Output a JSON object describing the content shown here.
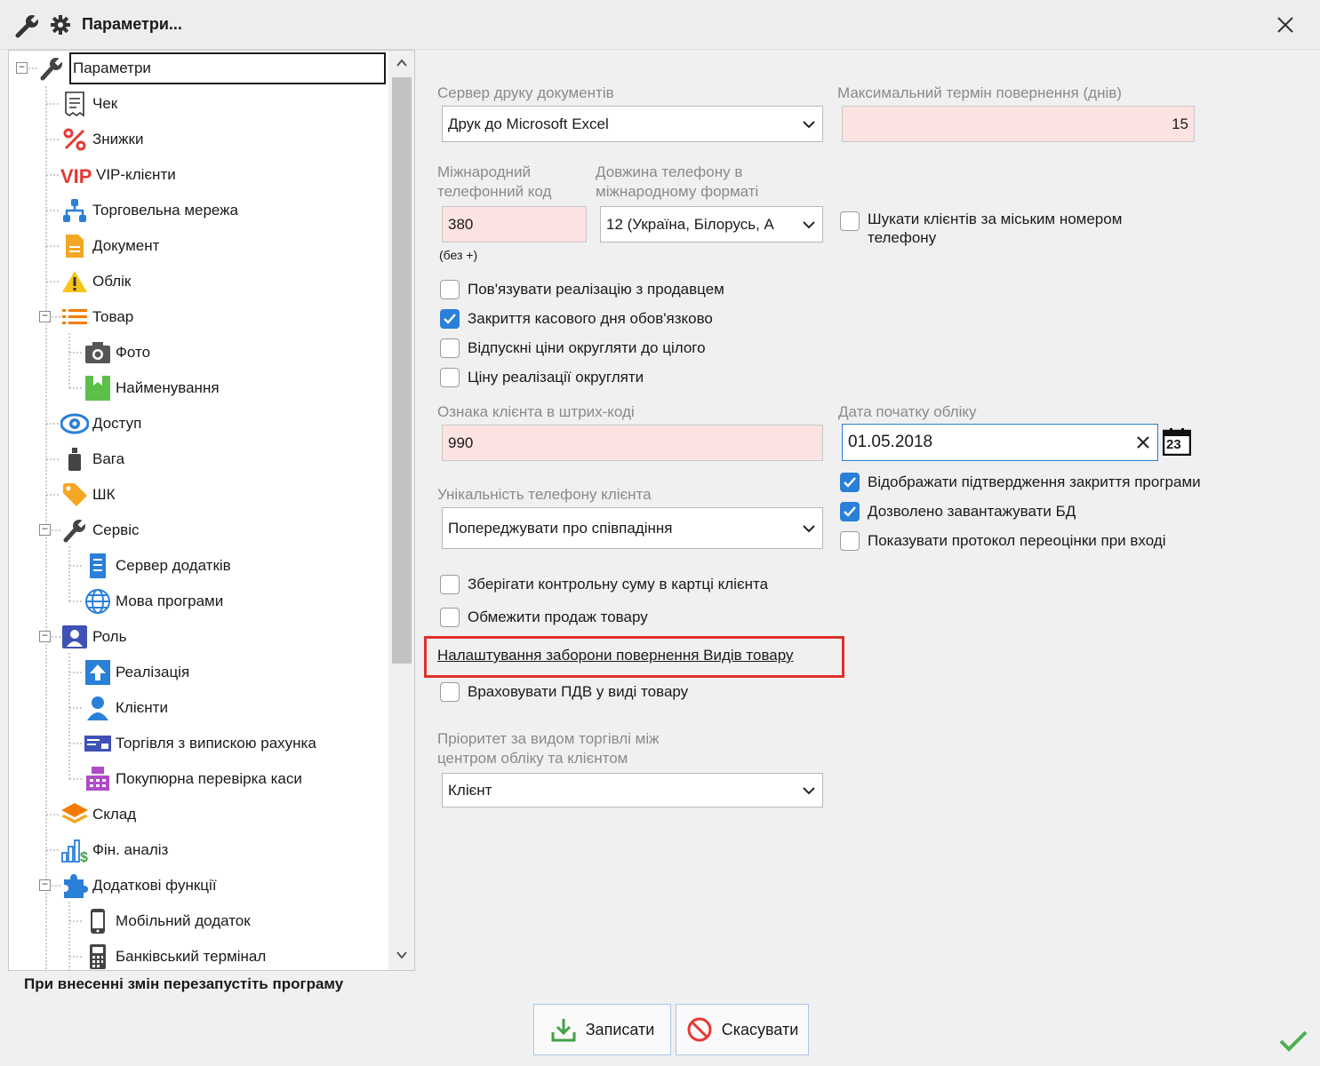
{
  "window": {
    "title": "Параметри..."
  },
  "tree": {
    "items": [
      {
        "label": "Параметри",
        "icon": "wrench-icon"
      },
      {
        "label": "Чек",
        "icon": "receipt-icon"
      },
      {
        "label": "Знижки",
        "icon": "percent-icon"
      },
      {
        "label": "VIP-клієнти",
        "icon": "vip-icon"
      },
      {
        "label": "Торговельна мережа",
        "icon": "network-icon"
      },
      {
        "label": "Документ",
        "icon": "document-icon"
      },
      {
        "label": "Облік",
        "icon": "warning-icon"
      },
      {
        "label": "Товар",
        "icon": "list-icon"
      },
      {
        "label": "Фото",
        "icon": "camera-icon"
      },
      {
        "label": "Найменування",
        "icon": "name-tag-icon"
      },
      {
        "label": "Доступ",
        "icon": "eye-icon"
      },
      {
        "label": "Вага",
        "icon": "weight-icon"
      },
      {
        "label": "ШК",
        "icon": "tag-icon"
      },
      {
        "label": "Сервіс",
        "icon": "wrench-icon"
      },
      {
        "label": "Сервер додатків",
        "icon": "server-icon"
      },
      {
        "label": "Мова програми",
        "icon": "globe-icon"
      },
      {
        "label": "Роль",
        "icon": "user-card-icon"
      },
      {
        "label": "Реалізація",
        "icon": "upload-icon"
      },
      {
        "label": "Клієнти",
        "icon": "person-icon"
      },
      {
        "label": "Торгівля з випискою рахунка",
        "icon": "invoice-icon"
      },
      {
        "label": "Покупюрна перевірка каси",
        "icon": "cash-register-icon"
      },
      {
        "label": "Склад",
        "icon": "layers-icon"
      },
      {
        "label": "Фін. аналіз",
        "icon": "finance-chart-icon"
      },
      {
        "label": "Додаткові функції",
        "icon": "puzzle-icon"
      },
      {
        "label": "Мобільний додаток",
        "icon": "mobile-icon"
      },
      {
        "label": "Банківський термінал",
        "icon": "terminal-icon"
      }
    ]
  },
  "restart_note": "При внесенні змін перезапустіть програму",
  "form": {
    "print_server": {
      "label": "Сервер друку документів",
      "value": "Друк до Microsoft Excel"
    },
    "max_return_days": {
      "label": "Максимальний термін повернення (днів)",
      "value": "15"
    },
    "intl_code": {
      "label_line1": "Міжнародний",
      "label_line2": "телефонний код",
      "value": "380",
      "hint": "(без +)"
    },
    "phone_length": {
      "label_line1": "Довжина телефону в",
      "label_line2": "міжнародному форматі",
      "value": "12 (Україна, Білорусь, А"
    },
    "search_city_phone": {
      "label_line1": "Шукати клієнтів за міським номером",
      "label_line2": "телефону",
      "checked": false
    },
    "checkboxes_left": [
      {
        "label": "Пов'язувати реалізацію з продавцем",
        "checked": false
      },
      {
        "label": "Закриття касового дня обов'язково",
        "checked": true
      },
      {
        "label": "Відпускні ціни округляти до цілого",
        "checked": false
      },
      {
        "label": "Ціну реалізації округляти",
        "checked": false
      }
    ],
    "barcode_client_sign": {
      "label": "Ознака клієнта в штрих-коді",
      "value": "990"
    },
    "start_date": {
      "label": "Дата початку обліку",
      "value": "01.05.2018",
      "calendar_day": "23"
    },
    "checkboxes_right": [
      {
        "label": "Відображати підтвердження закриття програми",
        "checked": true
      },
      {
        "label": "Дозволено завантажувати БД",
        "checked": true
      },
      {
        "label": "Показувати протокол переоцінки при вході",
        "checked": false
      }
    ],
    "phone_uniqueness": {
      "label": "Унікальність телефону клієнта",
      "value": "Попереджувати про співпадіння"
    },
    "checkboxes_left2": [
      {
        "label": "Зберігати контрольну суму в картці клієнта",
        "checked": false
      },
      {
        "label": "Обмежити продаж товару",
        "checked": false
      }
    ],
    "return_ban_link": "Налаштування заборони повернення Видів товару",
    "vat_in_product_type": {
      "label": "Враховувати ПДВ у виді товару",
      "checked": false
    },
    "priority": {
      "label_line1": "Пріоритет за видом торгівлі між",
      "label_line2": "центром обліку та клієнтом",
      "value": "Клієнт"
    }
  },
  "buttons": {
    "save": "Записати",
    "cancel": "Скасувати"
  },
  "colors": {
    "accent": "#2a7fd8",
    "highlight_border": "#e0302a",
    "pink_field": "#fde2e2",
    "ok_check": "#4caf50"
  }
}
